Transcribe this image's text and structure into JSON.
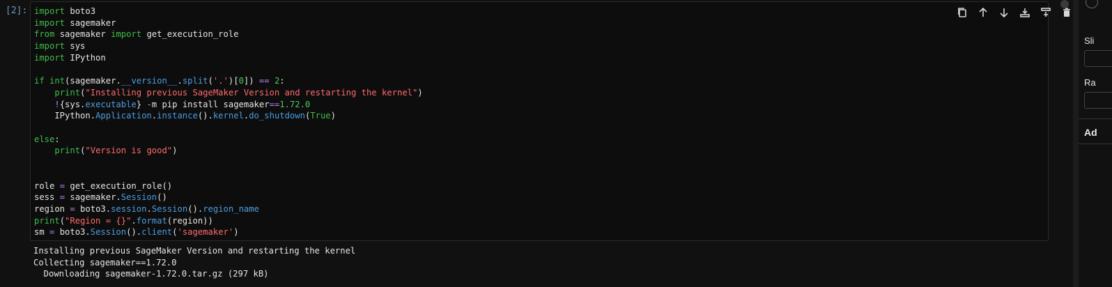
{
  "cell": {
    "prompt": "[2]:",
    "code_lines": [
      [
        {
          "t": "import",
          "c": "kw"
        },
        {
          "t": " boto3"
        }
      ],
      [
        {
          "t": "import",
          "c": "kw"
        },
        {
          "t": " sagemaker"
        }
      ],
      [
        {
          "t": "from",
          "c": "kw"
        },
        {
          "t": " sagemaker "
        },
        {
          "t": "import",
          "c": "kw"
        },
        {
          "t": " get_execution_role"
        }
      ],
      [
        {
          "t": "import",
          "c": "kw"
        },
        {
          "t": " sys"
        }
      ],
      [
        {
          "t": "import",
          "c": "kw"
        },
        {
          "t": " IPython"
        }
      ],
      [],
      [
        {
          "t": "if",
          "c": "kw"
        },
        {
          "t": " "
        },
        {
          "t": "int",
          "c": "kw"
        },
        {
          "t": "(sagemaker."
        },
        {
          "t": "__version__",
          "c": "attr"
        },
        {
          "t": "."
        },
        {
          "t": "split",
          "c": "attr"
        },
        {
          "t": "("
        },
        {
          "t": "'.'",
          "c": "str"
        },
        {
          "t": ")["
        },
        {
          "t": "0",
          "c": "num"
        },
        {
          "t": "]) "
        },
        {
          "t": "==",
          "c": "op"
        },
        {
          "t": " "
        },
        {
          "t": "2",
          "c": "num"
        },
        {
          "t": ":"
        }
      ],
      [
        {
          "t": "    "
        },
        {
          "t": "print",
          "c": "kw"
        },
        {
          "t": "("
        },
        {
          "t": "\"Installing previous SageMaker Version and restarting the kernel\"",
          "c": "str"
        },
        {
          "t": ")"
        }
      ],
      [
        {
          "t": "    "
        },
        {
          "t": "!",
          "c": "op"
        },
        {
          "t": "{sys."
        },
        {
          "t": "executable",
          "c": "attr"
        },
        {
          "t": "} "
        },
        {
          "t": "-",
          "c": "op"
        },
        {
          "t": "m pip install sagemaker"
        },
        {
          "t": "==",
          "c": "op"
        },
        {
          "t": "1.72.0",
          "c": "num"
        }
      ],
      [
        {
          "t": "    IPython."
        },
        {
          "t": "Application",
          "c": "attr"
        },
        {
          "t": "."
        },
        {
          "t": "instance",
          "c": "attr"
        },
        {
          "t": "()."
        },
        {
          "t": "kernel",
          "c": "attr"
        },
        {
          "t": "."
        },
        {
          "t": "do_shutdown",
          "c": "attr"
        },
        {
          "t": "("
        },
        {
          "t": "True",
          "c": "kw"
        },
        {
          "t": ")"
        }
      ],
      [],
      [
        {
          "t": "else",
          "c": "kw"
        },
        {
          "t": ":"
        }
      ],
      [
        {
          "t": "    "
        },
        {
          "t": "print",
          "c": "kw"
        },
        {
          "t": "("
        },
        {
          "t": "\"Version is good\"",
          "c": "str"
        },
        {
          "t": ")"
        }
      ],
      [],
      [],
      [
        {
          "t": "role "
        },
        {
          "t": "=",
          "c": "op"
        },
        {
          "t": " get_execution_role()"
        }
      ],
      [
        {
          "t": "sess "
        },
        {
          "t": "=",
          "c": "op"
        },
        {
          "t": " sagemaker."
        },
        {
          "t": "Session",
          "c": "attr"
        },
        {
          "t": "()"
        }
      ],
      [
        {
          "t": "region "
        },
        {
          "t": "=",
          "c": "op"
        },
        {
          "t": " boto3."
        },
        {
          "t": "session",
          "c": "attr"
        },
        {
          "t": "."
        },
        {
          "t": "Session",
          "c": "attr"
        },
        {
          "t": "()."
        },
        {
          "t": "region_name",
          "c": "attr"
        }
      ],
      [
        {
          "t": "print",
          "c": "kw"
        },
        {
          "t": "("
        },
        {
          "t": "\"Region = {}\"",
          "c": "str"
        },
        {
          "t": "."
        },
        {
          "t": "format",
          "c": "attr"
        },
        {
          "t": "(region))"
        }
      ],
      [
        {
          "t": "sm "
        },
        {
          "t": "=",
          "c": "op"
        },
        {
          "t": " boto3."
        },
        {
          "t": "Session",
          "c": "attr"
        },
        {
          "t": "()."
        },
        {
          "t": "client",
          "c": "attr"
        },
        {
          "t": "("
        },
        {
          "t": "'sagemaker'",
          "c": "str"
        },
        {
          "t": ")"
        }
      ]
    ],
    "output_lines": [
      "Installing previous SageMaker Version and restarting the kernel",
      "Collecting sagemaker==1.72.0",
      "  Downloading sagemaker-1.72.0.tar.gz (297 kB)"
    ]
  },
  "toolbar": {
    "buttons": [
      {
        "name": "duplicate-cell-button",
        "icon": "copy-icon"
      },
      {
        "name": "move-up-button",
        "icon": "arrow-up-icon"
      },
      {
        "name": "move-down-button",
        "icon": "arrow-down-icon"
      },
      {
        "name": "insert-above-button",
        "icon": "insert-above-icon"
      },
      {
        "name": "insert-below-button",
        "icon": "insert-below-icon"
      },
      {
        "name": "delete-cell-button",
        "icon": "trash-icon"
      }
    ]
  },
  "side_panel": {
    "label_1": "Sli",
    "label_2": "Ra",
    "section": "Ad"
  },
  "colors": {
    "background": "#111111",
    "keyword": "#3fbf4a",
    "string": "#ff6b6b",
    "attribute": "#4d9de0",
    "prompt": "#6e95c4"
  }
}
